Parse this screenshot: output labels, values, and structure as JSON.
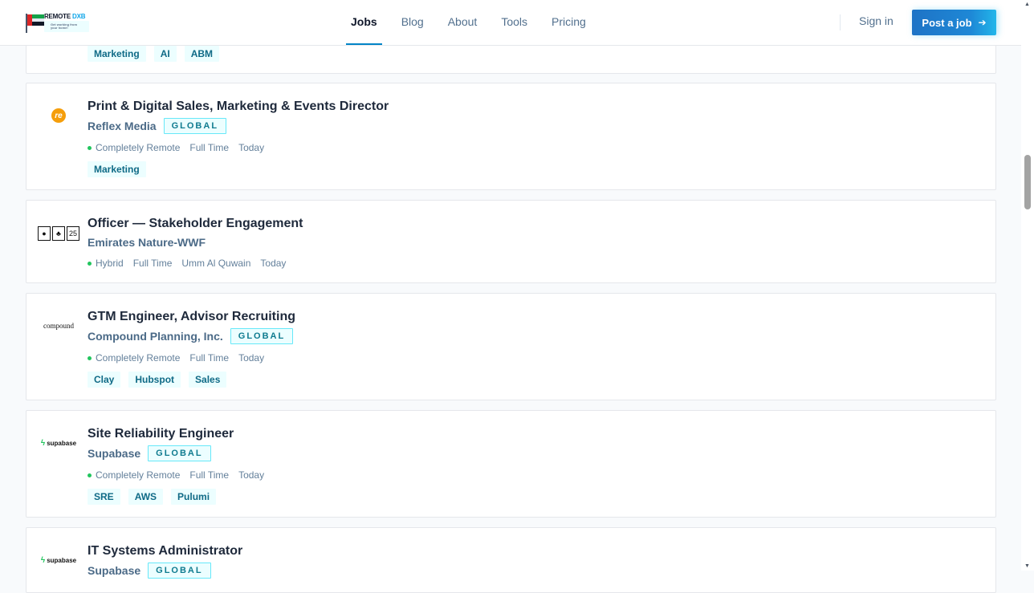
{
  "header": {
    "logo": {
      "name": "REMOTE DXB",
      "tagline": "Get working from your home!"
    },
    "nav": [
      {
        "label": "Jobs",
        "active": true
      },
      {
        "label": "Blog",
        "active": false
      },
      {
        "label": "About",
        "active": false
      },
      {
        "label": "Tools",
        "active": false
      },
      {
        "label": "Pricing",
        "active": false
      }
    ],
    "sign_in": "Sign in",
    "post_job": "Post a job",
    "post_job_icon": "arrow-right-icon"
  },
  "colors": {
    "accent": "#0284c7",
    "badge_border": "#67e8f9",
    "status_dot": "#22c55e"
  },
  "jobs": [
    {
      "tags": [
        "Marketing",
        "AI",
        "ABM"
      ]
    },
    {
      "title": "Print & Digital Sales, Marketing & Events Director",
      "company": "Reflex Media",
      "badge": "GLOBAL",
      "logo_text": "re",
      "meta": [
        "Completely Remote",
        "Full Time",
        "Today"
      ],
      "tags": [
        "Marketing"
      ]
    },
    {
      "title": "Officer — Stakeholder Engagement",
      "company": "Emirates Nature-WWF",
      "meta": [
        "Hybrid",
        "Full Time",
        "Umm Al Quwain",
        "Today"
      ],
      "tags": []
    },
    {
      "title": "GTM Engineer, Advisor Recruiting",
      "company": "Compound Planning, Inc.",
      "badge": "GLOBAL",
      "logo_text": "compound",
      "meta": [
        "Completely Remote",
        "Full Time",
        "Today"
      ],
      "tags": [
        "Clay",
        "Hubspot",
        "Sales"
      ]
    },
    {
      "title": "Site Reliability Engineer",
      "company": "Supabase",
      "badge": "GLOBAL",
      "logo_text": "supabase",
      "meta": [
        "Completely Remote",
        "Full Time",
        "Today"
      ],
      "tags": [
        "SRE",
        "AWS",
        "Pulumi"
      ]
    },
    {
      "title": "IT Systems Administrator",
      "company": "Supabase",
      "badge": "GLOBAL",
      "logo_text": "supabase"
    }
  ]
}
